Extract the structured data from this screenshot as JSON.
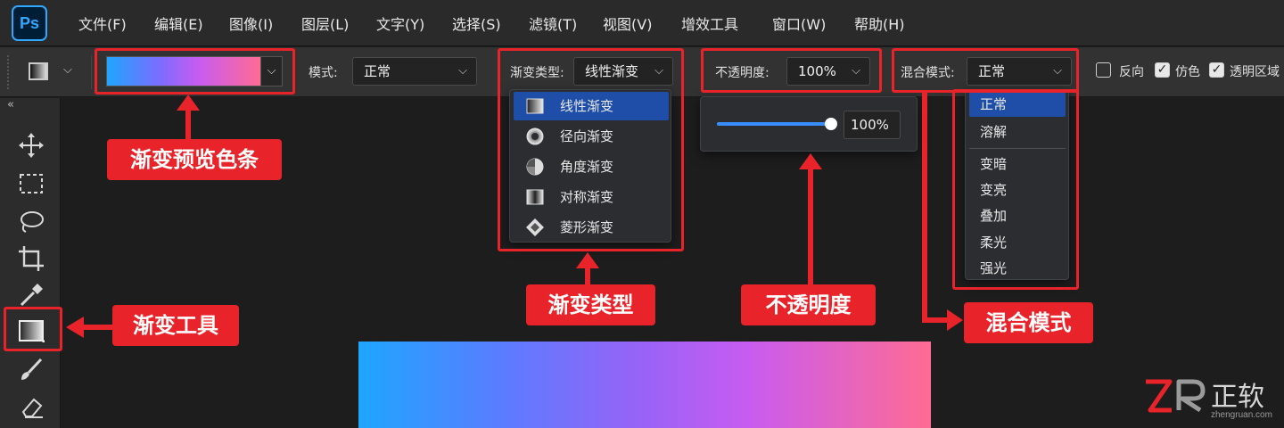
{
  "app": {
    "logo": "Ps"
  },
  "menu": [
    "文件(F)",
    "编辑(E)",
    "图像(I)",
    "图层(L)",
    "文字(Y)",
    "选择(S)",
    "滤镜(T)",
    "视图(V)",
    "增效工具",
    "窗口(W)",
    "帮助(H)"
  ],
  "options": {
    "mode_label": "模式:",
    "mode_value": "正常",
    "gradient_type_label": "渐变类型:",
    "gradient_type_value": "线性渐变",
    "opacity_label": "不透明度:",
    "opacity_value": "100%",
    "blend_label": "混合模式:",
    "blend_value": "正常",
    "reverse_label": "反向",
    "reverse_checked": false,
    "dither_label": "仿色",
    "dither_checked": true,
    "transparency_label": "透明区域",
    "transparency_checked": true
  },
  "gradient_types": [
    {
      "label": "线性渐变",
      "icon": "linear-gradient-icon",
      "selected": true
    },
    {
      "label": "径向渐变",
      "icon": "radial-gradient-icon",
      "selected": false
    },
    {
      "label": "角度渐变",
      "icon": "angle-gradient-icon",
      "selected": false
    },
    {
      "label": "对称渐变",
      "icon": "reflected-gradient-icon",
      "selected": false
    },
    {
      "label": "菱形渐变",
      "icon": "diamond-gradient-icon",
      "selected": false
    }
  ],
  "opacity_slider": {
    "value": 1.0,
    "readout": "100%"
  },
  "blend_modes": [
    {
      "label": "正常",
      "selected": true
    },
    {
      "label": "溶解",
      "selected": false
    },
    {
      "label": "变暗",
      "selected": false
    },
    {
      "label": "变亮",
      "selected": false
    },
    {
      "label": "叠加",
      "selected": false
    },
    {
      "label": "柔光",
      "selected": false
    },
    {
      "label": "强光",
      "selected": false
    }
  ],
  "callouts": {
    "gradient_preview": "渐变预览色条",
    "gradient_tool": "渐变工具",
    "gradient_type": "渐变类型",
    "opacity": "不透明度",
    "blend_mode": "混合模式"
  },
  "watermark": {
    "brand": "正软",
    "url": "zhengruan.com"
  },
  "colors": {
    "accent_red": "#e8242a",
    "selection_blue": "#1e4ea8",
    "gradient_start": "#1ea6ff",
    "gradient_end": "#ff6b93"
  }
}
